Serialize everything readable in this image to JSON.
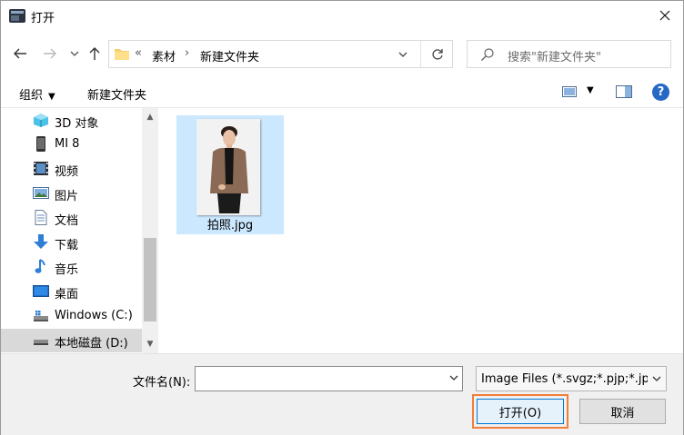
{
  "window": {
    "title": "打开",
    "close_icon": "close-icon"
  },
  "nav": {
    "back_icon": "arrow-left-icon",
    "forward_icon": "arrow-right-icon",
    "recent_icon": "chevron-down-icon",
    "up_icon": "arrow-up-icon",
    "address": {
      "overflow": "«",
      "segments": [
        "素材",
        "新建文件夹"
      ],
      "separator": "›"
    },
    "refresh_icon": "refresh-icon",
    "search_placeholder": "搜索\"新建文件夹\""
  },
  "toolbar": {
    "organize_label": "组织",
    "new_folder_label": "新建文件夹",
    "help_label": "?"
  },
  "sidebar": {
    "items": [
      {
        "label": "3D 对象",
        "icon": "3d-objects-icon"
      },
      {
        "label": "MI 8",
        "icon": "phone-icon"
      },
      {
        "label": "视频",
        "icon": "video-icon"
      },
      {
        "label": "图片",
        "icon": "pictures-icon"
      },
      {
        "label": "文档",
        "icon": "documents-icon"
      },
      {
        "label": "下载",
        "icon": "download-icon"
      },
      {
        "label": "音乐",
        "icon": "music-icon"
      },
      {
        "label": "桌面",
        "icon": "desktop-icon"
      },
      {
        "label": "Windows (C:)",
        "icon": "windows-drive-icon"
      },
      {
        "label": "本地磁盘 (D:)",
        "icon": "local-disk-icon",
        "selected": true
      }
    ]
  },
  "files": [
    {
      "name": "拍照.jpg",
      "icon": "image-thumbnail-icon",
      "selected": true
    }
  ],
  "footer": {
    "filename_label": "文件名(N):",
    "filename_value": "",
    "filetype_value": "Image Files (*.svgz;*.pjp;*.jpeg",
    "open_label": "打开(O)",
    "cancel_label": "取消"
  },
  "colors": {
    "accent": "#0078d7",
    "selection": "#cce8ff",
    "highlight_annotation": "#f07f3c",
    "help": "#2668c4"
  }
}
